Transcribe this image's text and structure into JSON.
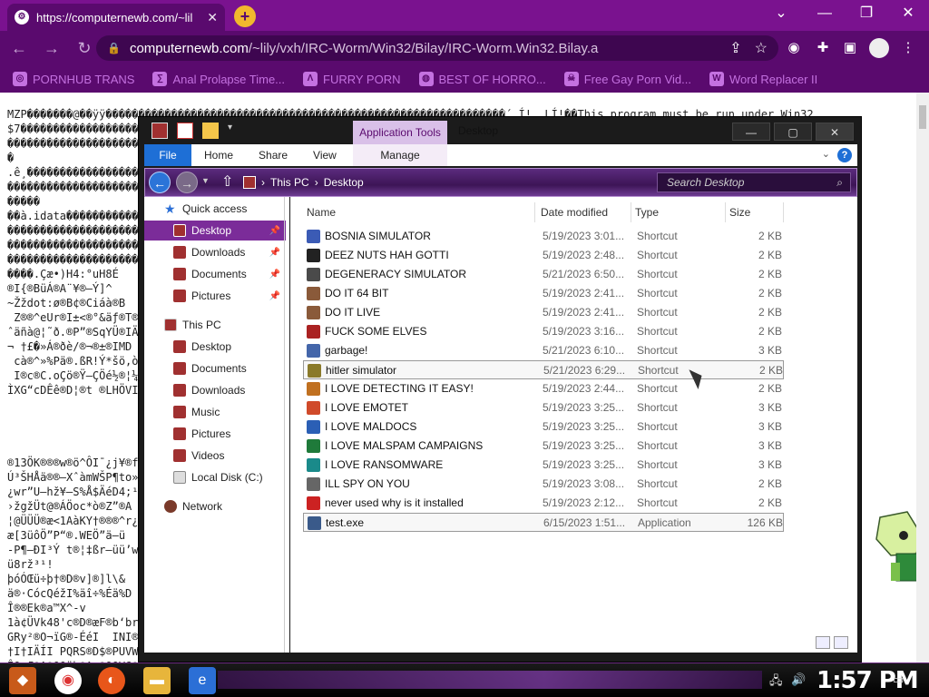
{
  "browser": {
    "tab_title": "https://computernewb.com/~lil",
    "new_tab": "+",
    "url_host": "computernewb.com",
    "url_path": "/~lily/vxh/IRC-Worm/Win32/Bilay/IRC-Worm.Win32.Bilay.a",
    "bookmarks": [
      {
        "label": "PORNHUB TRANS",
        "icon": "ph-icon"
      },
      {
        "label": "Anal Prolapse Time...",
        "icon": "link-icon"
      },
      {
        "label": "FURRY PORN",
        "icon": "lambda-icon"
      },
      {
        "label": "BEST OF HORRO...",
        "icon": "globe-icon"
      },
      {
        "label": "Free Gay Porn Vid...",
        "icon": "skull-icon"
      },
      {
        "label": "Word Replacer II",
        "icon": "wr-icon"
      }
    ]
  },
  "page": {
    "garbage_text": "MZP�������@��ÿÿ�������������������������������������������������������������´ Í!¸ LÍ!��This program must be run under Win32\n$7�������������������������������������������������������������������������������\n������������������������������������������������������������������à���\n�\n.ê¸����������������������������������������������������������������������������¨À��\n�������������������������������������������������������������������������������\n�����\n��à.idata�������������������������������������������������������������������\n�������������������������������������������������������������������������������\n�������������������������������������������������������������������������������\n�������������������������������������������������������������������������������\n����.Çæ•)H4:°uH8É\n®I{®BüÁ®A¨¥®–Ý]^\n~Žždot:ø®B¢®Ciáà®B\n Z®®^eUr®I±<®°&äƒ®T®Bi\nˆäñà@¦˜ð.®P”®SqYÜ®IÄ\n¬ †£�»Á®ðè/®¬®±®IMD\n cà®^»%Pä®.ßR!Ý*šö,ò\n I®c®C.oÇö®Ÿ–ÇÖé½®¦¼¹ð\nÌXG“cDÊê®D¦®t ®LHÖVI",
    "garbage_text_lower": "®13ÖK®®®w®ö^ÔI¯¿j¥®f1\nÚ³ŠHÅä®®–XˆàmWŠP¶to»\n¿wr”U–hž¥–S%Å$ÄéD4;¹\n›žgžÜt@®ÁÖoc*ò®Z”®A\n¦@ÜÜÜ®æ<1AàKY†®®®^r¿XP\næ[3üôÖ”P“®.WEÖ”ä–ü\n-P¶–ÐI³Ý t®¦‡ßr–üü’w\nü8rž³¹!\nþóÓŒü÷þ†®D®v]®]l\\&\nä®·CócQéžI%äî÷%Éä%D\nÎ®®Ek®a™X^-v\n1à¢ÜVk48'c®D®æF®b‘brš\nGRy²®O¬ïG®-ÉéI  INI®\n†I†IÄÍI PQRS®D$®PUVWR\nÎQ Æ®A®OQüþ®A<®OQVG®G"
  },
  "explorer": {
    "app_tools": "Application Tools",
    "caption": "Desktop",
    "ribbon": {
      "file": "File",
      "home": "Home",
      "share": "Share",
      "view": "View",
      "manage": "Manage"
    },
    "path": [
      "This PC",
      "Desktop"
    ],
    "search_placeholder": "Search Desktop",
    "sidebar": [
      {
        "label": "Quick access",
        "icon": "star-icon"
      },
      {
        "label": "Desktop",
        "icon": "desktop-icon",
        "selected": true,
        "pinned": true
      },
      {
        "label": "Downloads",
        "icon": "downloads-icon",
        "pinned": true
      },
      {
        "label": "Documents",
        "icon": "documents-icon",
        "pinned": true
      },
      {
        "label": "Pictures",
        "icon": "pictures-icon",
        "pinned": true
      },
      {
        "label": "This PC",
        "icon": "pc-icon"
      },
      {
        "label": "Desktop",
        "icon": "desktop-icon"
      },
      {
        "label": "Documents",
        "icon": "documents-icon"
      },
      {
        "label": "Downloads",
        "icon": "downloads-icon"
      },
      {
        "label": "Music",
        "icon": "music-icon"
      },
      {
        "label": "Pictures",
        "icon": "pictures-icon"
      },
      {
        "label": "Videos",
        "icon": "videos-icon"
      },
      {
        "label": "Local Disk (C:)",
        "icon": "disk-icon"
      },
      {
        "label": "Network",
        "icon": "network-icon"
      }
    ],
    "columns": {
      "name": "Name",
      "date": "Date modified",
      "type": "Type",
      "size": "Size"
    },
    "files": [
      {
        "name": "BOSNIA SIMULATOR",
        "date": "5/19/2023 3:01...",
        "type": "Shortcut",
        "size": "2 KB",
        "color": "#3b5bb5"
      },
      {
        "name": "DEEZ NUTS HAH GOTTI",
        "date": "5/19/2023 2:48...",
        "type": "Shortcut",
        "size": "2 KB",
        "color": "#222222"
      },
      {
        "name": "DEGENERACY SIMULATOR",
        "date": "5/21/2023 6:50...",
        "type": "Shortcut",
        "size": "2 KB",
        "color": "#4a4a4a"
      },
      {
        "name": "DO IT 64 BIT",
        "date": "5/19/2023 2:41...",
        "type": "Shortcut",
        "size": "2 KB",
        "color": "#8a5a3a"
      },
      {
        "name": "DO IT LIVE",
        "date": "5/19/2023 2:41...",
        "type": "Shortcut",
        "size": "2 KB",
        "color": "#8a5a3a"
      },
      {
        "name": "FUCK SOME ELVES",
        "date": "5/19/2023 3:16...",
        "type": "Shortcut",
        "size": "2 KB",
        "color": "#aa2222"
      },
      {
        "name": "garbage!",
        "date": "5/21/2023 6:10...",
        "type": "Shortcut",
        "size": "3 KB",
        "color": "#4466aa"
      },
      {
        "name": "hitler simulator",
        "date": "5/21/2023 6:29...",
        "type": "Shortcut",
        "size": "2 KB",
        "color": "#8a7a2a",
        "selected": true
      },
      {
        "name": "I LOVE DETECTING IT EASY!",
        "date": "5/19/2023 2:44...",
        "type": "Shortcut",
        "size": "2 KB",
        "color": "#c07020"
      },
      {
        "name": "I LOVE EMOTET",
        "date": "5/19/2023 3:25...",
        "type": "Shortcut",
        "size": "3 KB",
        "color": "#d04a2a"
      },
      {
        "name": "I LOVE MALDOCS",
        "date": "5/19/2023 3:25...",
        "type": "Shortcut",
        "size": "3 KB",
        "color": "#2b5fb5"
      },
      {
        "name": "I LOVE MALSPAM CAMPAIGNS",
        "date": "5/19/2023 3:25...",
        "type": "Shortcut",
        "size": "3 KB",
        "color": "#1f7a3a"
      },
      {
        "name": "I LOVE RANSOMWARE",
        "date": "5/19/2023 3:25...",
        "type": "Shortcut",
        "size": "3 KB",
        "color": "#1a8a8a"
      },
      {
        "name": "ILL SPY ON YOU",
        "date": "5/19/2023 3:08...",
        "type": "Shortcut",
        "size": "2 KB",
        "color": "#666666"
      },
      {
        "name": "never used why is it installed",
        "date": "5/19/2023 2:12...",
        "type": "Shortcut",
        "size": "2 KB",
        "color": "#cc2222"
      },
      {
        "name": "test.exe",
        "date": "6/15/2023 1:51...",
        "type": "Application",
        "size": "126 KB",
        "color": "#3a5a8a",
        "selected": true
      }
    ]
  },
  "taskbar": {
    "clock": "1:57 PM"
  }
}
